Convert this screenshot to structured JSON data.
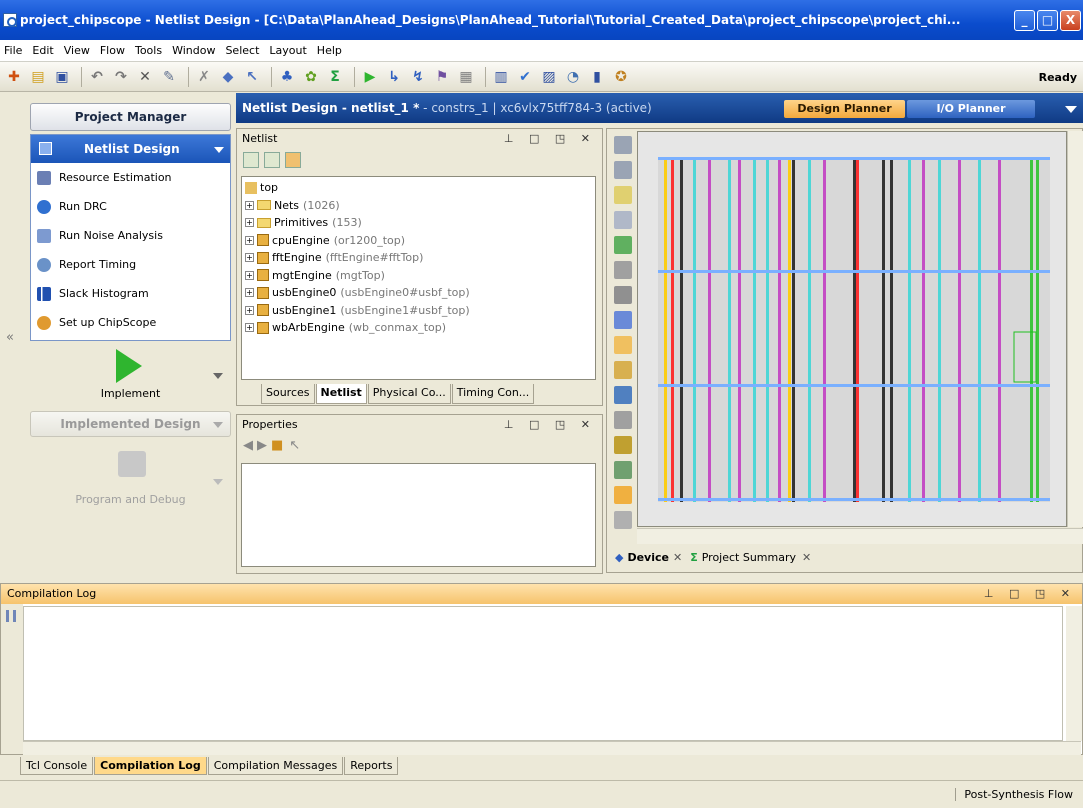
{
  "window": {
    "title": "project_chipscope - Netlist Design - [C:\\Data\\PlanAhead_Designs\\PlanAhead_Tutorial\\Tutorial_Created_Data\\project_chipscope\\project_chi...",
    "min": "_",
    "max": "□",
    "close": "X"
  },
  "menu": [
    "File",
    "Edit",
    "View",
    "Flow",
    "Tools",
    "Window",
    "Select",
    "Layout",
    "Help"
  ],
  "toolbar": {
    "status": "Ready"
  },
  "flow": {
    "project_manager": "Project Manager",
    "netlist_design": "Netlist Design",
    "items": [
      "Resource Estimation",
      "Run DRC",
      "Run Noise Analysis",
      "Report Timing",
      "Slack Histogram",
      "Set up ChipScope"
    ],
    "implement": "Implement",
    "implemented_design": "Implemented Design",
    "program_debug": "Program and Debug"
  },
  "banner": {
    "title": "Netlist Design - netlist_1 *",
    "sub": " - constrs_1 | xc6vlx75tff784-3 (active)",
    "design_planner": "Design Planner",
    "io_planner": "I/O Planner"
  },
  "netlist": {
    "header": "Netlist",
    "root": "top",
    "nodes": [
      {
        "name": "Nets",
        "detail": "(1026)",
        "kind": "folder"
      },
      {
        "name": "Primitives",
        "detail": "(153)",
        "kind": "folder"
      },
      {
        "name": "cpuEngine",
        "detail": "(or1200_top)",
        "kind": "cell"
      },
      {
        "name": "fftEngine",
        "detail": "(fftEngine#fftTop)",
        "kind": "cell"
      },
      {
        "name": "mgtEngine",
        "detail": "(mgtTop)",
        "kind": "cell"
      },
      {
        "name": "usbEngine0",
        "detail": "(usbEngine0#usbf_top)",
        "kind": "cell"
      },
      {
        "name": "usbEngine1",
        "detail": "(usbEngine1#usbf_top)",
        "kind": "cell"
      },
      {
        "name": "wbArbEngine",
        "detail": "(wb_conmax_top)",
        "kind": "cell"
      }
    ],
    "tabs": [
      "Sources",
      "Netlist",
      "Physical Co...",
      "Timing Con..."
    ],
    "active_tab": "Netlist"
  },
  "properties": {
    "header": "Properties"
  },
  "device": {
    "tabs": [
      "Device",
      "Project Summary"
    ]
  },
  "log": {
    "header": "Compilation Log",
    "tabs": [
      "Tcl Console",
      "Compilation Log",
      "Compilation Messages",
      "Reports"
    ]
  },
  "status": {
    "flow": "Post-Synthesis Flow"
  },
  "colors": {
    "accent": "#1b55b8",
    "device_cyan": "#3fd6d6",
    "device_magenta": "#c23fc2",
    "device_green": "#2fc42f"
  }
}
